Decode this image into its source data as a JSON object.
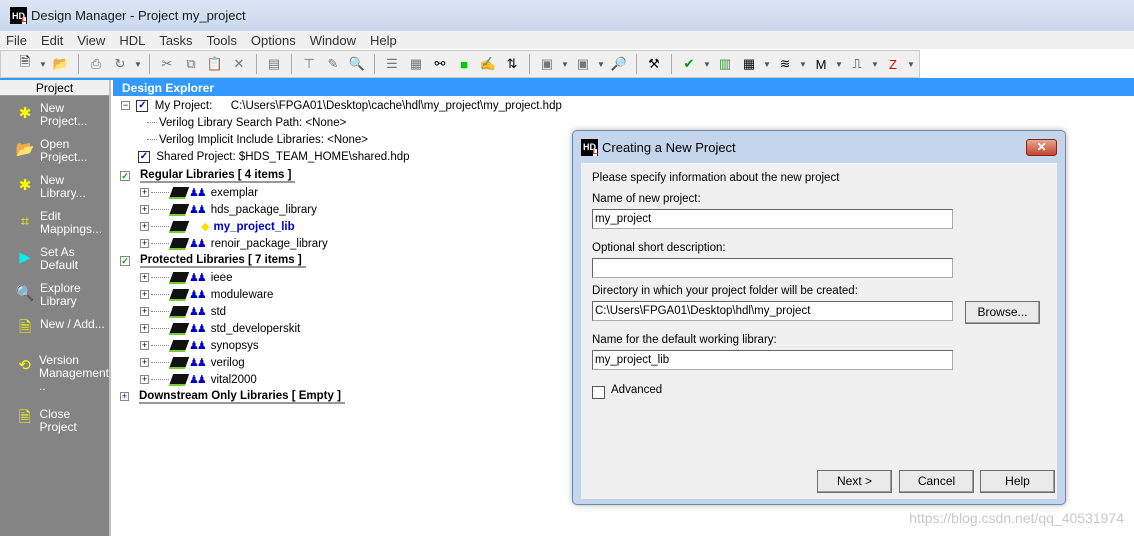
{
  "window": {
    "title": "Design Manager - Project my_project",
    "logo": "HDL"
  },
  "menu": [
    "File",
    "Edit",
    "View",
    "HDL",
    "Tasks",
    "Tools",
    "Options",
    "Window",
    "Help"
  ],
  "toolbar": {
    "icons": [
      "new-file-icon",
      "open-folder-icon",
      "print-icon",
      "refresh-icon",
      "cut-icon",
      "copy-icon",
      "paste-icon",
      "delete-icon",
      "properties-icon",
      "hierarchy-icon",
      "edit-pen-icon",
      "explore-icon",
      "list-view-icon",
      "components-icon",
      "find-binoculars-icon",
      "green-chip-icon",
      "notepad-edit-icon",
      "swap-icon",
      "checkin-icon",
      "checkout-icon",
      "zoom-search-icon",
      "build-hammer-icon",
      "check-icon",
      "simulator-icon",
      "block-diagram-icon",
      "stack-edit-icon",
      "modelsim-icon",
      "synthesis-icon",
      "red-tool-icon"
    ]
  },
  "sidebar": {
    "header": "Project",
    "items": [
      {
        "label": "New\nProject...",
        "icon": "new-project-icon"
      },
      {
        "label": "Open\nProject...",
        "icon": "open-project-icon"
      },
      {
        "label": "New\nLibrary...",
        "icon": "new-library-icon"
      },
      {
        "label": "Edit\nMappings...",
        "icon": "edit-mappings-icon"
      },
      {
        "label": "Set As\nDefault",
        "icon": "play-triangle-icon"
      },
      {
        "label": "Explore\nLibrary",
        "icon": "explore-library-icon"
      },
      {
        "label": "New / Add...",
        "icon": "new-add-icon"
      },
      {
        "label": "Version\nManagement\n..",
        "icon": "version-management-icon"
      },
      {
        "label": "Close Project",
        "icon": "close-project-icon"
      }
    ]
  },
  "explorer": {
    "header": "Design Explorer",
    "my_project_label": "My Project:",
    "my_project_path": "C:\\Users\\FPGA01\\Desktop\\cache\\hdl\\my_project\\my_project.hdp",
    "verilog_search": "Verilog Library Search Path:  <None>",
    "verilog_include": "Verilog Implicit Include Libraries:  <None>",
    "shared_project": "Shared Project: $HDS_TEAM_HOME\\shared.hdp",
    "regular_header": "Regular Libraries [ 4 items ]",
    "regular": [
      "exemplar",
      "hds_package_library",
      "my_project_lib",
      "renoir_package_library"
    ],
    "protected_header": "Protected Libraries [ 7 items ]",
    "protected": [
      "ieee",
      "moduleware",
      "std",
      "std_developerskit",
      "synopsys",
      "verilog",
      "vital2000"
    ],
    "downstream_header": "Downstream Only Libraries [ Empty ]"
  },
  "dialog": {
    "title": "Creating a New Project",
    "intro": "Please specify information about the new project",
    "name_label": "Name of new project:",
    "name_value": "my_project",
    "desc_label": "Optional short description:",
    "desc_value": "",
    "dir_label": "Directory in which your project folder will be created:",
    "dir_value": "C:\\Users\\FPGA01\\Desktop\\hdl\\my_project",
    "browse": "Browse...",
    "lib_label": "Name for the default working library:",
    "lib_value": "my_project_lib",
    "advanced": "Advanced",
    "advanced_checked": false,
    "next": "Next >",
    "cancel": "Cancel",
    "help": "Help",
    "close": "✕"
  },
  "watermark": "https://blog.csdn.net/qq_40531974"
}
